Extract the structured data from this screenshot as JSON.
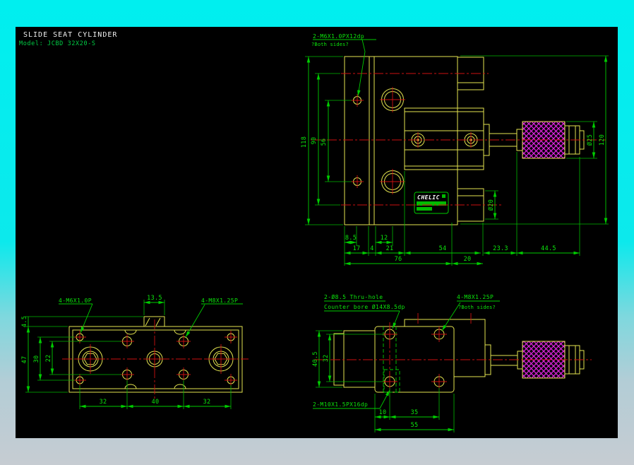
{
  "title_block": {
    "title": "SLIDE SEAT CYLINDER",
    "model": "Model: JCBD 32X20-S"
  },
  "brand": {
    "logo": "CHELIC"
  },
  "front_view": {
    "note_top": "2-M6X1.0PX12dp",
    "note_top_sub": "?Both sides?",
    "dim_118": "118",
    "dim_90": "90",
    "dim_56": "56",
    "dim_8_5": "8.5",
    "dim_12": "12",
    "dim_17": "17",
    "dim_4": "4",
    "dim_21": "21",
    "dim_54": "54",
    "dim_76": "76",
    "dim_20": "20",
    "dim_23_3": "23.3",
    "dim_44_5": "44.5",
    "dim_dia25": "Ø25",
    "dim_120": "120",
    "dim_dia20": "Ø20"
  },
  "top_view": {
    "note_m6": "4-M6X1.0P",
    "note_m8": "4-M8X1.25P",
    "dim_13_5": "13.5",
    "dim_4_5": "4.5",
    "dim_47": "47",
    "dim_30": "30",
    "dim_22": "22",
    "dim_32a": "32",
    "dim_40": "40",
    "dim_32b": "32"
  },
  "side_view": {
    "note_thru": "2-Ø8.5  Thru-hole",
    "note_cbore": "Counter bore  Ø14X8.5dp",
    "note_m8": "4-M8X1.25P",
    "note_m8_sub": "?Both sides?",
    "note_m10": "2-M10X1.5PX16dp",
    "dim_40_5": "40.5",
    "dim_32": "32",
    "dim_10": "10",
    "dim_35": "35",
    "dim_55": "55"
  },
  "colors": {
    "line_yellow": "#e3e34f",
    "dim_green": "#00cc00",
    "center_red": "#cc1111",
    "knurl_magenta": "#d926d9",
    "canvas_black": "#000000",
    "app_cyan": "#00efef"
  }
}
